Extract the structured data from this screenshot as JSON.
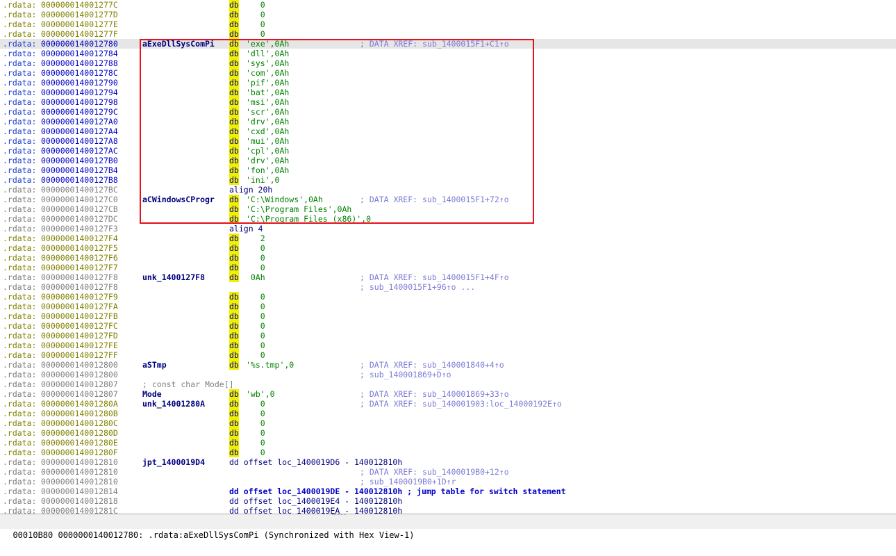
{
  "rows": [
    {
      "seg": ".rdata:",
      "addr": "000000014001277C",
      "name": "",
      "mn": "db",
      "op": "   0",
      "optype": "num",
      "cmt": "",
      "style": "pre"
    },
    {
      "seg": ".rdata:",
      "addr": "000000014001277D",
      "name": "",
      "mn": "db",
      "op": "   0",
      "optype": "num",
      "cmt": "",
      "style": "pre"
    },
    {
      "seg": ".rdata:",
      "addr": "000000014001277E",
      "name": "",
      "mn": "db",
      "op": "   0",
      "optype": "num",
      "cmt": "",
      "style": "pre"
    },
    {
      "seg": ".rdata:",
      "addr": "000000014001277F",
      "name": "",
      "mn": "db",
      "op": "   0",
      "optype": "num",
      "cmt": "",
      "style": "pre"
    },
    {
      "seg": ".rdata:",
      "addr": "0000000140012780",
      "name": "aExeDllSysComPi",
      "mn": "db",
      "op": "'exe',0Ah",
      "optype": "str",
      "cmt": "; DATA XREF: sub_1400015F1+C1↑o",
      "style": "lab",
      "current": true
    },
    {
      "seg": ".rdata:",
      "addr": "0000000140012784",
      "name": "",
      "mn": "db",
      "op": "'dll',0Ah",
      "optype": "str",
      "cmt": "",
      "style": "lab"
    },
    {
      "seg": ".rdata:",
      "addr": "0000000140012788",
      "name": "",
      "mn": "db",
      "op": "'sys',0Ah",
      "optype": "str",
      "cmt": "",
      "style": "lab"
    },
    {
      "seg": ".rdata:",
      "addr": "000000014001278C",
      "name": "",
      "mn": "db",
      "op": "'com',0Ah",
      "optype": "str",
      "cmt": "",
      "style": "lab"
    },
    {
      "seg": ".rdata:",
      "addr": "0000000140012790",
      "name": "",
      "mn": "db",
      "op": "'pif',0Ah",
      "optype": "str",
      "cmt": "",
      "style": "lab"
    },
    {
      "seg": ".rdata:",
      "addr": "0000000140012794",
      "name": "",
      "mn": "db",
      "op": "'bat',0Ah",
      "optype": "str",
      "cmt": "",
      "style": "lab"
    },
    {
      "seg": ".rdata:",
      "addr": "0000000140012798",
      "name": "",
      "mn": "db",
      "op": "'msi',0Ah",
      "optype": "str",
      "cmt": "",
      "style": "lab"
    },
    {
      "seg": ".rdata:",
      "addr": "000000014001279C",
      "name": "",
      "mn": "db",
      "op": "'scr',0Ah",
      "optype": "str",
      "cmt": "",
      "style": "lab"
    },
    {
      "seg": ".rdata:",
      "addr": "00000001400127A0",
      "name": "",
      "mn": "db",
      "op": "'drv',0Ah",
      "optype": "str",
      "cmt": "",
      "style": "lab"
    },
    {
      "seg": ".rdata:",
      "addr": "00000001400127A4",
      "name": "",
      "mn": "db",
      "op": "'cxd',0Ah",
      "optype": "str",
      "cmt": "",
      "style": "lab"
    },
    {
      "seg": ".rdata:",
      "addr": "00000001400127A8",
      "name": "",
      "mn": "db",
      "op": "'mui',0Ah",
      "optype": "str",
      "cmt": "",
      "style": "lab"
    },
    {
      "seg": ".rdata:",
      "addr": "00000001400127AC",
      "name": "",
      "mn": "db",
      "op": "'cpl',0Ah",
      "optype": "str",
      "cmt": "",
      "style": "lab"
    },
    {
      "seg": ".rdata:",
      "addr": "00000001400127B0",
      "name": "",
      "mn": "db",
      "op": "'drv',0Ah",
      "optype": "str",
      "cmt": "",
      "style": "lab"
    },
    {
      "seg": ".rdata:",
      "addr": "00000001400127B4",
      "name": "",
      "mn": "db",
      "op": "'fon',0Ah",
      "optype": "str",
      "cmt": "",
      "style": "lab"
    },
    {
      "seg": ".rdata:",
      "addr": "00000001400127B8",
      "name": "",
      "mn": "db",
      "op": "'ini',0",
      "optype": "str",
      "cmt": "",
      "style": "lab"
    },
    {
      "seg": ".rdata:",
      "addr": "00000001400127BC",
      "name": "",
      "mn": "align 20h",
      "op": "",
      "optype": "off",
      "cmt": "",
      "style": "plain",
      "nohl": true
    },
    {
      "seg": ".rdata:",
      "addr": "00000001400127C0",
      "name": "aCWindowsCProgr",
      "mn": "db",
      "op": "'C:\\Windows',0Ah",
      "optype": "str",
      "cmt": "; DATA XREF: sub_1400015F1+72↑o",
      "style": "plain"
    },
    {
      "seg": ".rdata:",
      "addr": "00000001400127CB",
      "name": "",
      "mn": "db",
      "op": "'C:\\Program Files',0Ah",
      "optype": "str",
      "cmt": "",
      "style": "plain"
    },
    {
      "seg": ".rdata:",
      "addr": "00000001400127DC",
      "name": "",
      "mn": "db",
      "op": "'C:\\Program Files (x86)',0",
      "optype": "str",
      "cmt": "",
      "style": "plain"
    },
    {
      "seg": ".rdata:",
      "addr": "00000001400127F3",
      "name": "",
      "mn": "align 4",
      "op": "",
      "optype": "off",
      "cmt": "",
      "style": "plain",
      "nohl": true
    },
    {
      "seg": ".rdata:",
      "addr": "00000001400127F4",
      "name": "",
      "mn": "db",
      "op": "   2",
      "optype": "num",
      "cmt": "",
      "style": "pre"
    },
    {
      "seg": ".rdata:",
      "addr": "00000001400127F5",
      "name": "",
      "mn": "db",
      "op": "   0",
      "optype": "num",
      "cmt": "",
      "style": "pre"
    },
    {
      "seg": ".rdata:",
      "addr": "00000001400127F6",
      "name": "",
      "mn": "db",
      "op": "   0",
      "optype": "num",
      "cmt": "",
      "style": "pre"
    },
    {
      "seg": ".rdata:",
      "addr": "00000001400127F7",
      "name": "",
      "mn": "db",
      "op": "   0",
      "optype": "num",
      "cmt": "",
      "style": "pre"
    },
    {
      "seg": ".rdata:",
      "addr": "00000001400127F8",
      "name": "unk_1400127F8",
      "mn": "db",
      "op": " 0Ah",
      "optype": "num",
      "cmt": "; DATA XREF: sub_1400015F1+4F↑o",
      "style": "plain"
    },
    {
      "seg": ".rdata:",
      "addr": "00000001400127F8",
      "name": "",
      "mn": "",
      "op": "",
      "optype": "num",
      "cmt": "; sub_1400015F1+96↑o ...",
      "style": "plain"
    },
    {
      "seg": ".rdata:",
      "addr": "00000001400127F9",
      "name": "",
      "mn": "db",
      "op": "   0",
      "optype": "num",
      "cmt": "",
      "style": "pre"
    },
    {
      "seg": ".rdata:",
      "addr": "00000001400127FA",
      "name": "",
      "mn": "db",
      "op": "   0",
      "optype": "num",
      "cmt": "",
      "style": "pre"
    },
    {
      "seg": ".rdata:",
      "addr": "00000001400127FB",
      "name": "",
      "mn": "db",
      "op": "   0",
      "optype": "num",
      "cmt": "",
      "style": "pre"
    },
    {
      "seg": ".rdata:",
      "addr": "00000001400127FC",
      "name": "",
      "mn": "db",
      "op": "   0",
      "optype": "num",
      "cmt": "",
      "style": "pre"
    },
    {
      "seg": ".rdata:",
      "addr": "00000001400127FD",
      "name": "",
      "mn": "db",
      "op": "   0",
      "optype": "num",
      "cmt": "",
      "style": "pre"
    },
    {
      "seg": ".rdata:",
      "addr": "00000001400127FE",
      "name": "",
      "mn": "db",
      "op": "   0",
      "optype": "num",
      "cmt": "",
      "style": "pre"
    },
    {
      "seg": ".rdata:",
      "addr": "00000001400127FF",
      "name": "",
      "mn": "db",
      "op": "   0",
      "optype": "num",
      "cmt": "",
      "style": "pre"
    },
    {
      "seg": ".rdata:",
      "addr": "0000000140012800",
      "name": "aSTmp",
      "mn": "db",
      "op": "'%s.tmp',0",
      "optype": "str",
      "cmt": "; DATA XREF: sub_140001840+4↑o",
      "style": "plain"
    },
    {
      "seg": ".rdata:",
      "addr": "0000000140012800",
      "name": "",
      "mn": "",
      "op": "",
      "optype": "num",
      "cmt": "; sub_140001869+D↑o",
      "style": "plain"
    },
    {
      "seg": ".rdata:",
      "addr": "0000000140012807",
      "name": "",
      "mn": "",
      "op": "",
      "optype": "num",
      "cmt": "",
      "style": "plain",
      "line_comment": "; const char Mode[]"
    },
    {
      "seg": ".rdata:",
      "addr": "0000000140012807",
      "name": "Mode",
      "mn": "db",
      "op": "'wb',0",
      "optype": "str",
      "cmt": "; DATA XREF: sub_140001869+33↑o",
      "style": "plain"
    },
    {
      "seg": ".rdata:",
      "addr": "000000014001280A",
      "name": "unk_14001280A",
      "mn": "db",
      "op": "   0",
      "optype": "num",
      "cmt": "; DATA XREF: sub_140001903:loc_14000192E↑o",
      "style": "pre"
    },
    {
      "seg": ".rdata:",
      "addr": "000000014001280B",
      "name": "",
      "mn": "db",
      "op": "   0",
      "optype": "num",
      "cmt": "",
      "style": "pre"
    },
    {
      "seg": ".rdata:",
      "addr": "000000014001280C",
      "name": "",
      "mn": "db",
      "op": "   0",
      "optype": "num",
      "cmt": "",
      "style": "pre"
    },
    {
      "seg": ".rdata:",
      "addr": "000000014001280D",
      "name": "",
      "mn": "db",
      "op": "   0",
      "optype": "num",
      "cmt": "",
      "style": "pre"
    },
    {
      "seg": ".rdata:",
      "addr": "000000014001280E",
      "name": "",
      "mn": "db",
      "op": "   0",
      "optype": "num",
      "cmt": "",
      "style": "pre"
    },
    {
      "seg": ".rdata:",
      "addr": "000000014001280F",
      "name": "",
      "mn": "db",
      "op": "   0",
      "optype": "num",
      "cmt": "",
      "style": "pre"
    },
    {
      "seg": ".rdata:",
      "addr": "0000000140012810",
      "name": "jpt_1400019D4",
      "mn": "dd offset loc_1400019D6 - 140012810h",
      "op": "",
      "optype": "off",
      "cmt": "",
      "style": "plain",
      "nohl": true
    },
    {
      "seg": ".rdata:",
      "addr": "0000000140012810",
      "name": "",
      "mn": "",
      "op": "",
      "optype": "num",
      "cmt": "; DATA XREF: sub_1400019B0+12↑o",
      "style": "plain"
    },
    {
      "seg": ".rdata:",
      "addr": "0000000140012810",
      "name": "",
      "mn": "",
      "op": "",
      "optype": "num",
      "cmt": "; sub_1400019B0+1D↑r",
      "style": "plain"
    },
    {
      "seg": ".rdata:",
      "addr": "0000000140012814",
      "name": "",
      "mn": "dd offset loc_1400019DE - 140012810h ; jump table for switch statement",
      "op": "",
      "optype": "off",
      "cmt": "",
      "style": "plain",
      "nohl": true,
      "dark": true
    },
    {
      "seg": ".rdata:",
      "addr": "0000000140012818",
      "name": "",
      "mn": "dd offset loc_1400019E4 - 140012810h",
      "op": "",
      "optype": "off",
      "cmt": "",
      "style": "plain",
      "nohl": true
    },
    {
      "seg": ".rdata:",
      "addr": "000000014001281C",
      "name": "",
      "mn": "dd offset loc_1400019EA - 140012810h",
      "op": "",
      "optype": "off",
      "cmt": "",
      "style": "plain",
      "nohl": true
    }
  ],
  "status": {
    "text": "00010B80 0000000140012780: .rdata:aExeDllSysComPi (Synchronized with Hex View-1)"
  },
  "highlight": {
    "color": "#e8101a"
  }
}
